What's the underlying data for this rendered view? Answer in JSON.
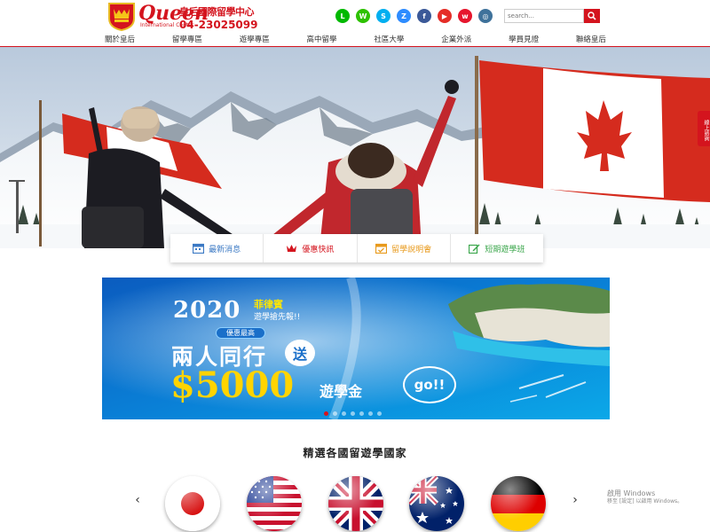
{
  "brand": {
    "name": "Queen",
    "name_cn": "皇后國際留學中心",
    "subtitle": "International Center",
    "phone": "04-23025099"
  },
  "socials": [
    {
      "name": "line-icon",
      "glyph": "L",
      "color": "#00b900"
    },
    {
      "name": "wechat-icon",
      "glyph": "W",
      "color": "#2dc100"
    },
    {
      "name": "skype-icon",
      "glyph": "S",
      "color": "#00aff0"
    },
    {
      "name": "zoom-icon",
      "glyph": "Z",
      "color": "#2d8cff"
    },
    {
      "name": "facebook-icon",
      "glyph": "f",
      "color": "#3b5998"
    },
    {
      "name": "youtube-icon",
      "glyph": "▶",
      "color": "#e52d27"
    },
    {
      "name": "weibo-icon",
      "glyph": "w",
      "color": "#e6162d"
    },
    {
      "name": "instagram-icon",
      "glyph": "◎",
      "color": "#3f729b"
    }
  ],
  "search": {
    "placeholder": "search..."
  },
  "nav": [
    "關於皇后",
    "留學專區",
    "遊學專區",
    "高中留學",
    "社區大學",
    "企業外派",
    "學員見證",
    "聯絡皇后"
  ],
  "side_tab": {
    "label": "線上諮詢"
  },
  "quick_links": [
    {
      "label": "最新消息",
      "icon": "calendar-icon",
      "color": "#3b79c4"
    },
    {
      "label": "優惠快訊",
      "icon": "crown-icon",
      "color": "#d4141e"
    },
    {
      "label": "留學說明會",
      "icon": "calendar-check-icon",
      "color": "#e89a1c"
    },
    {
      "label": "短期遊學班",
      "icon": "edit-icon",
      "color": "#3aa64b"
    }
  ],
  "promo": {
    "year": "2020",
    "sub1": "菲律賓",
    "sub2": "遊學搶先報!!",
    "pill": "優惠最高",
    "main": "兩人同行",
    "gift": "送",
    "money": "$5000",
    "money_label": "遊學金",
    "cta": "go!!",
    "slide_count": 7,
    "active_slide": 1
  },
  "countries": {
    "title": "精選各國留遊學國家",
    "prev": "‹",
    "next": "›",
    "items": [
      {
        "name": "japan",
        "flag": "japan-flag-icon"
      },
      {
        "name": "usa",
        "flag": "usa-flag-icon"
      },
      {
        "name": "uk",
        "flag": "uk-flag-icon"
      },
      {
        "name": "australia",
        "flag": "australia-flag-icon"
      },
      {
        "name": "germany",
        "flag": "germany-flag-icon"
      }
    ]
  },
  "watermark": {
    "line1": "啟用 Windows",
    "line2": "移至 [設定] 以啟用 Windows。"
  },
  "colors": {
    "accent": "#d4141e",
    "nav_text": "#333333",
    "promo_blue": "#0a4fa8",
    "promo_gold": "#ffd400"
  }
}
